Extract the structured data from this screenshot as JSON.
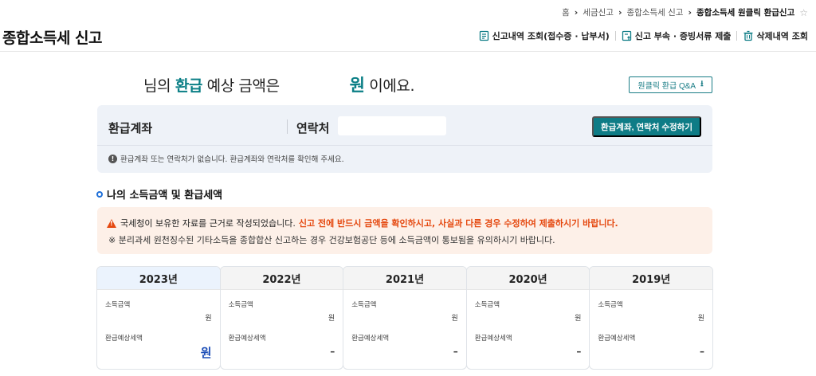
{
  "breadcrumb": {
    "items": [
      "홈",
      "세금신고",
      "종합소득세 신고"
    ],
    "current": "종합소득세 원클릭 환급신고",
    "separator": "›"
  },
  "header": {
    "title": "종합소득세 신고",
    "links": [
      {
        "label": "신고내역 조회(접수증 · 납부서)",
        "icon": "document-list-icon"
      },
      {
        "label": "신고 부속 · 증빙서류 제출",
        "icon": "document-upload-icon"
      },
      {
        "label": "삭제내역 조회",
        "icon": "trash-icon"
      }
    ]
  },
  "headline": {
    "prefix": "님의",
    "accent": "환급",
    "middle": "예상 금액은",
    "won": "원",
    "suffix": "이에요."
  },
  "qa_button": {
    "label": "원클릭 환급 Q&A",
    "icon": "download-icon"
  },
  "account": {
    "account_label": "환급계좌",
    "contact_label": "연락처",
    "contact_value": "",
    "edit_button": "환급계좌, 연락처 수정하기",
    "notice": "환급계좌 또는 연락처가 없습니다. 환급계좌와 연락처를 확인해 주세요."
  },
  "section": {
    "title": "나의 소득금액 및 환급세액"
  },
  "warning": {
    "line1_normal": "국세청이 보유한 자료를 근거로 작성되었습니다.",
    "line1_red": "신고 전에 반드시 금액을 확인하시고, 사실과 다른 경우 수정하여 제출하시기 바랍니다.",
    "line2": "※ 분리과세 원천징수된 기타소득을 종합합산 신고하는 경우 건강보험공단 등에 소득금액이 통보됨을 유의하시기 바랍니다."
  },
  "years": [
    {
      "year": "2023년",
      "income_label": "소득금액",
      "income_value": "원",
      "refund_label": "환급예상세액",
      "refund_value": "원",
      "active": true
    },
    {
      "year": "2022년",
      "income_label": "소득금액",
      "income_value": "원",
      "refund_label": "환급예상세액",
      "refund_value": "–",
      "active": false
    },
    {
      "year": "2021년",
      "income_label": "소득금액",
      "income_value": "원",
      "refund_label": "환급예상세액",
      "refund_value": "–",
      "active": false
    },
    {
      "year": "2020년",
      "income_label": "소득금액",
      "income_value": "원",
      "refund_label": "환급예상세액",
      "refund_value": "–",
      "active": false
    },
    {
      "year": "2019년",
      "income_label": "소득금액",
      "income_value": "원",
      "refund_label": "환급예상세액",
      "refund_value": "–",
      "active": false
    }
  ],
  "colors": {
    "accent_teal": "#0b7f86",
    "button_teal": "#0e7c86",
    "warning_red": "#e5480f",
    "active_blue": "#1e4fb8",
    "account_bg": "#eef2f8",
    "warning_bg": "#fdf0e8"
  }
}
